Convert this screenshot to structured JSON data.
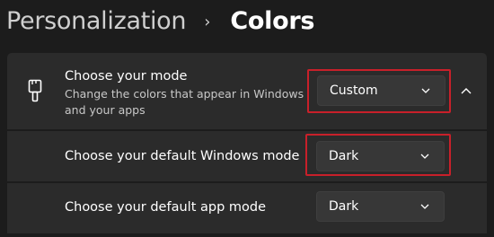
{
  "breadcrumb": {
    "parent": "Personalization",
    "separator": "›",
    "current": "Colors"
  },
  "mode_card": {
    "icon": "paintbrush-icon",
    "title": "Choose your mode",
    "description": "Change the colors that appear in Windows and your apps",
    "dropdown_value": "Custom",
    "expanded": true
  },
  "windows_mode": {
    "label": "Choose your default Windows mode",
    "dropdown_value": "Dark"
  },
  "app_mode": {
    "label": "Choose your default app mode",
    "dropdown_value": "Dark"
  },
  "colors": {
    "background": "#1c1c1c",
    "card": "#2b2b2b",
    "dropdown": "#373737",
    "highlight": "#c8202a"
  }
}
